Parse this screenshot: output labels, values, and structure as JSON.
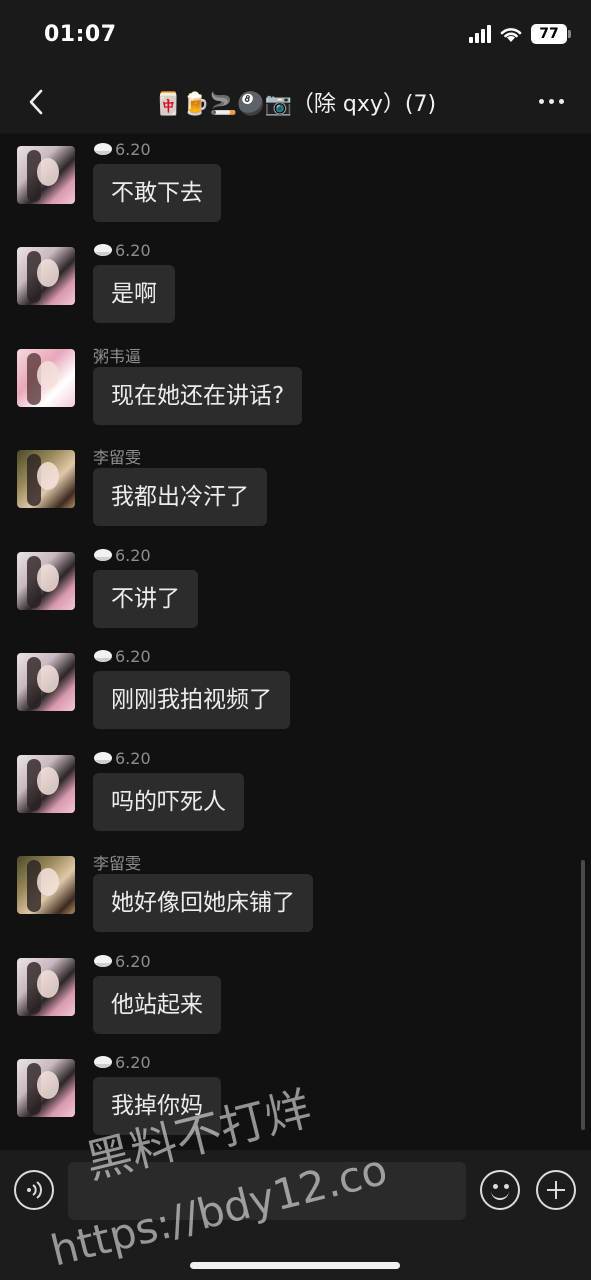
{
  "status": {
    "time": "01:07",
    "battery": "77"
  },
  "header": {
    "title_emojis": "🀄🍺🚬🎱📷",
    "title_text": "（除 qxy）(7)"
  },
  "messages": [
    {
      "sender": "6.20",
      "sender_icon": "rice-bowl-icon",
      "text": "不敢下去",
      "avatar": "a"
    },
    {
      "sender": "6.20",
      "sender_icon": "rice-bowl-icon",
      "text": "是啊",
      "avatar": "a"
    },
    {
      "sender": "粥韦逼",
      "sender_icon": "",
      "text": "现在她还在讲话?",
      "avatar": "b"
    },
    {
      "sender": "李留雯",
      "sender_icon": "",
      "text": "我都出冷汗了",
      "avatar": "c"
    },
    {
      "sender": "6.20",
      "sender_icon": "rice-bowl-icon",
      "text": "不讲了",
      "avatar": "a"
    },
    {
      "sender": "6.20",
      "sender_icon": "rice-bowl-icon",
      "text": "刚刚我拍视频了",
      "avatar": "a"
    },
    {
      "sender": "6.20",
      "sender_icon": "rice-bowl-icon",
      "text": "吗的吓死人",
      "avatar": "a"
    },
    {
      "sender": "李留雯",
      "sender_icon": "",
      "text": "她好像回她床铺了",
      "avatar": "c"
    },
    {
      "sender": "6.20",
      "sender_icon": "rice-bowl-icon",
      "text": "他站起来",
      "avatar": "a"
    },
    {
      "sender": "6.20",
      "sender_icon": "rice-bowl-icon",
      "text": "我掉你妈",
      "avatar": "a"
    }
  ],
  "watermark": {
    "line1": "黑料不打烊",
    "line2": "https://bdy12.co"
  }
}
